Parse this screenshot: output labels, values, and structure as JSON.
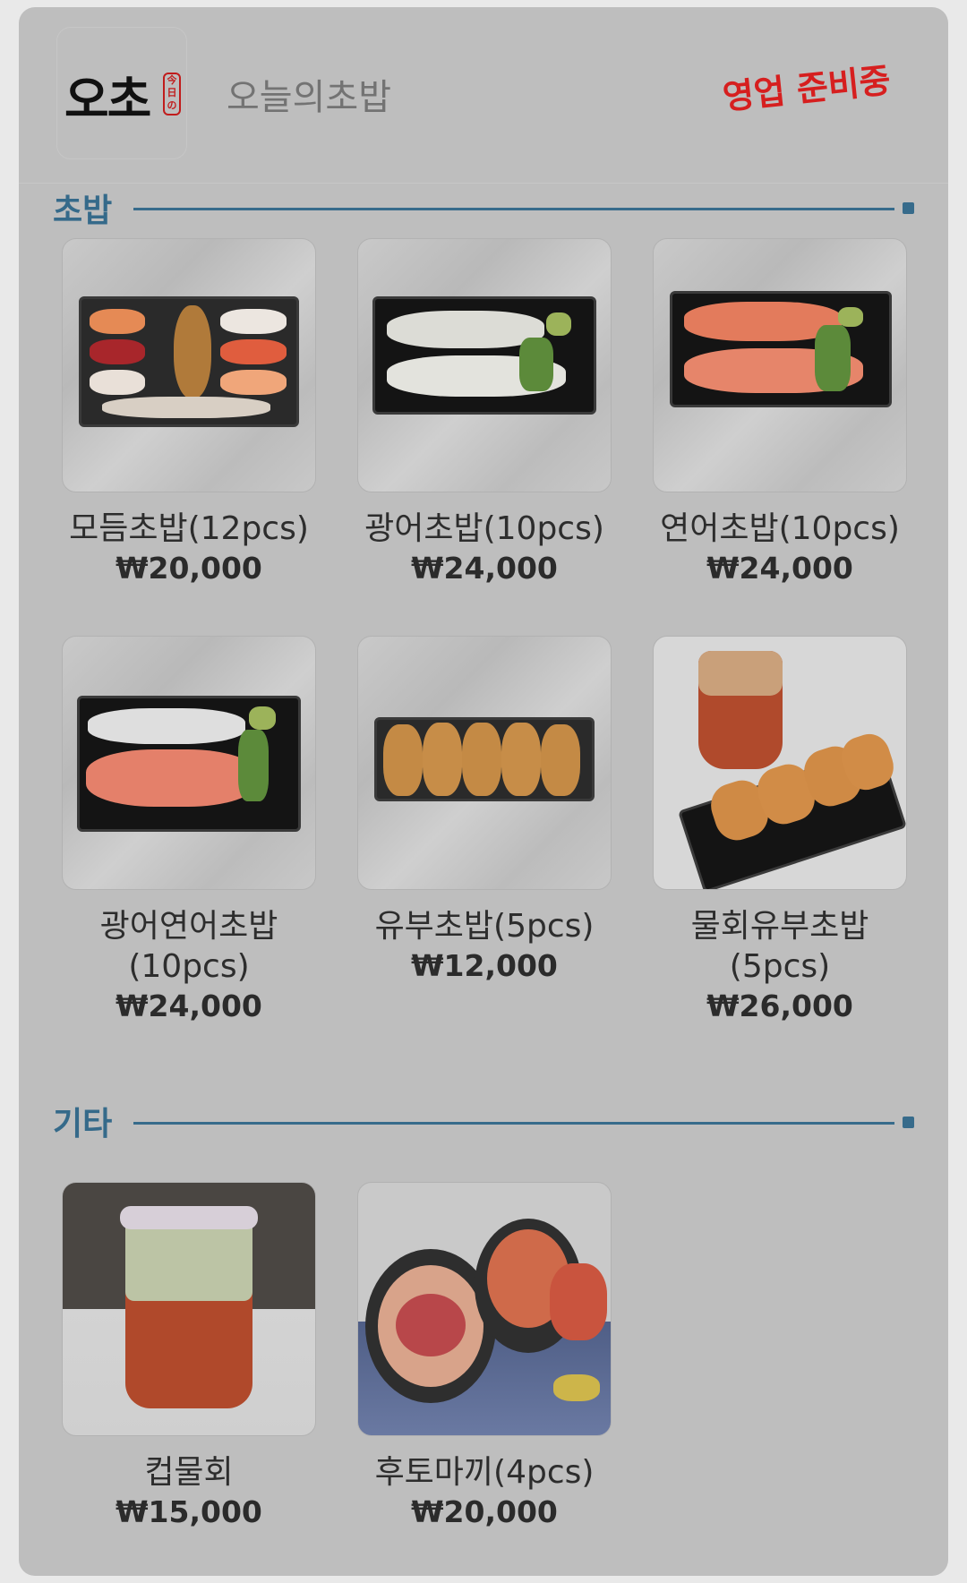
{
  "header": {
    "logo_text": "오초",
    "logo_seal_text": "今日の",
    "store_name": "오늘의초밥",
    "status_text": "영업 준비중"
  },
  "sections": [
    {
      "title": "초밥",
      "items": [
        {
          "name": "모듬초밥(12pcs)",
          "price": "₩20,000"
        },
        {
          "name": "광어초밥(10pcs)",
          "price": "₩24,000"
        },
        {
          "name": "연어초밥(10pcs)",
          "price": "₩24,000"
        },
        {
          "name_line1": "광어연어초밥",
          "name_line2": "(10pcs)",
          "price": "₩24,000"
        },
        {
          "name": "유부초밥(5pcs)",
          "price": "₩12,000"
        },
        {
          "name_line1": "물회유부초밥",
          "name_line2": "(5pcs)",
          "price": "₩26,000"
        }
      ]
    },
    {
      "title": "기타",
      "items": [
        {
          "name": "컵물회",
          "price": "₩15,000"
        },
        {
          "name": "후토마끼(4pcs)",
          "price": "₩20,000"
        }
      ]
    }
  ],
  "colors": {
    "panel": "#bebebe",
    "accent": "#376b8b",
    "status": "#d61f1f"
  }
}
